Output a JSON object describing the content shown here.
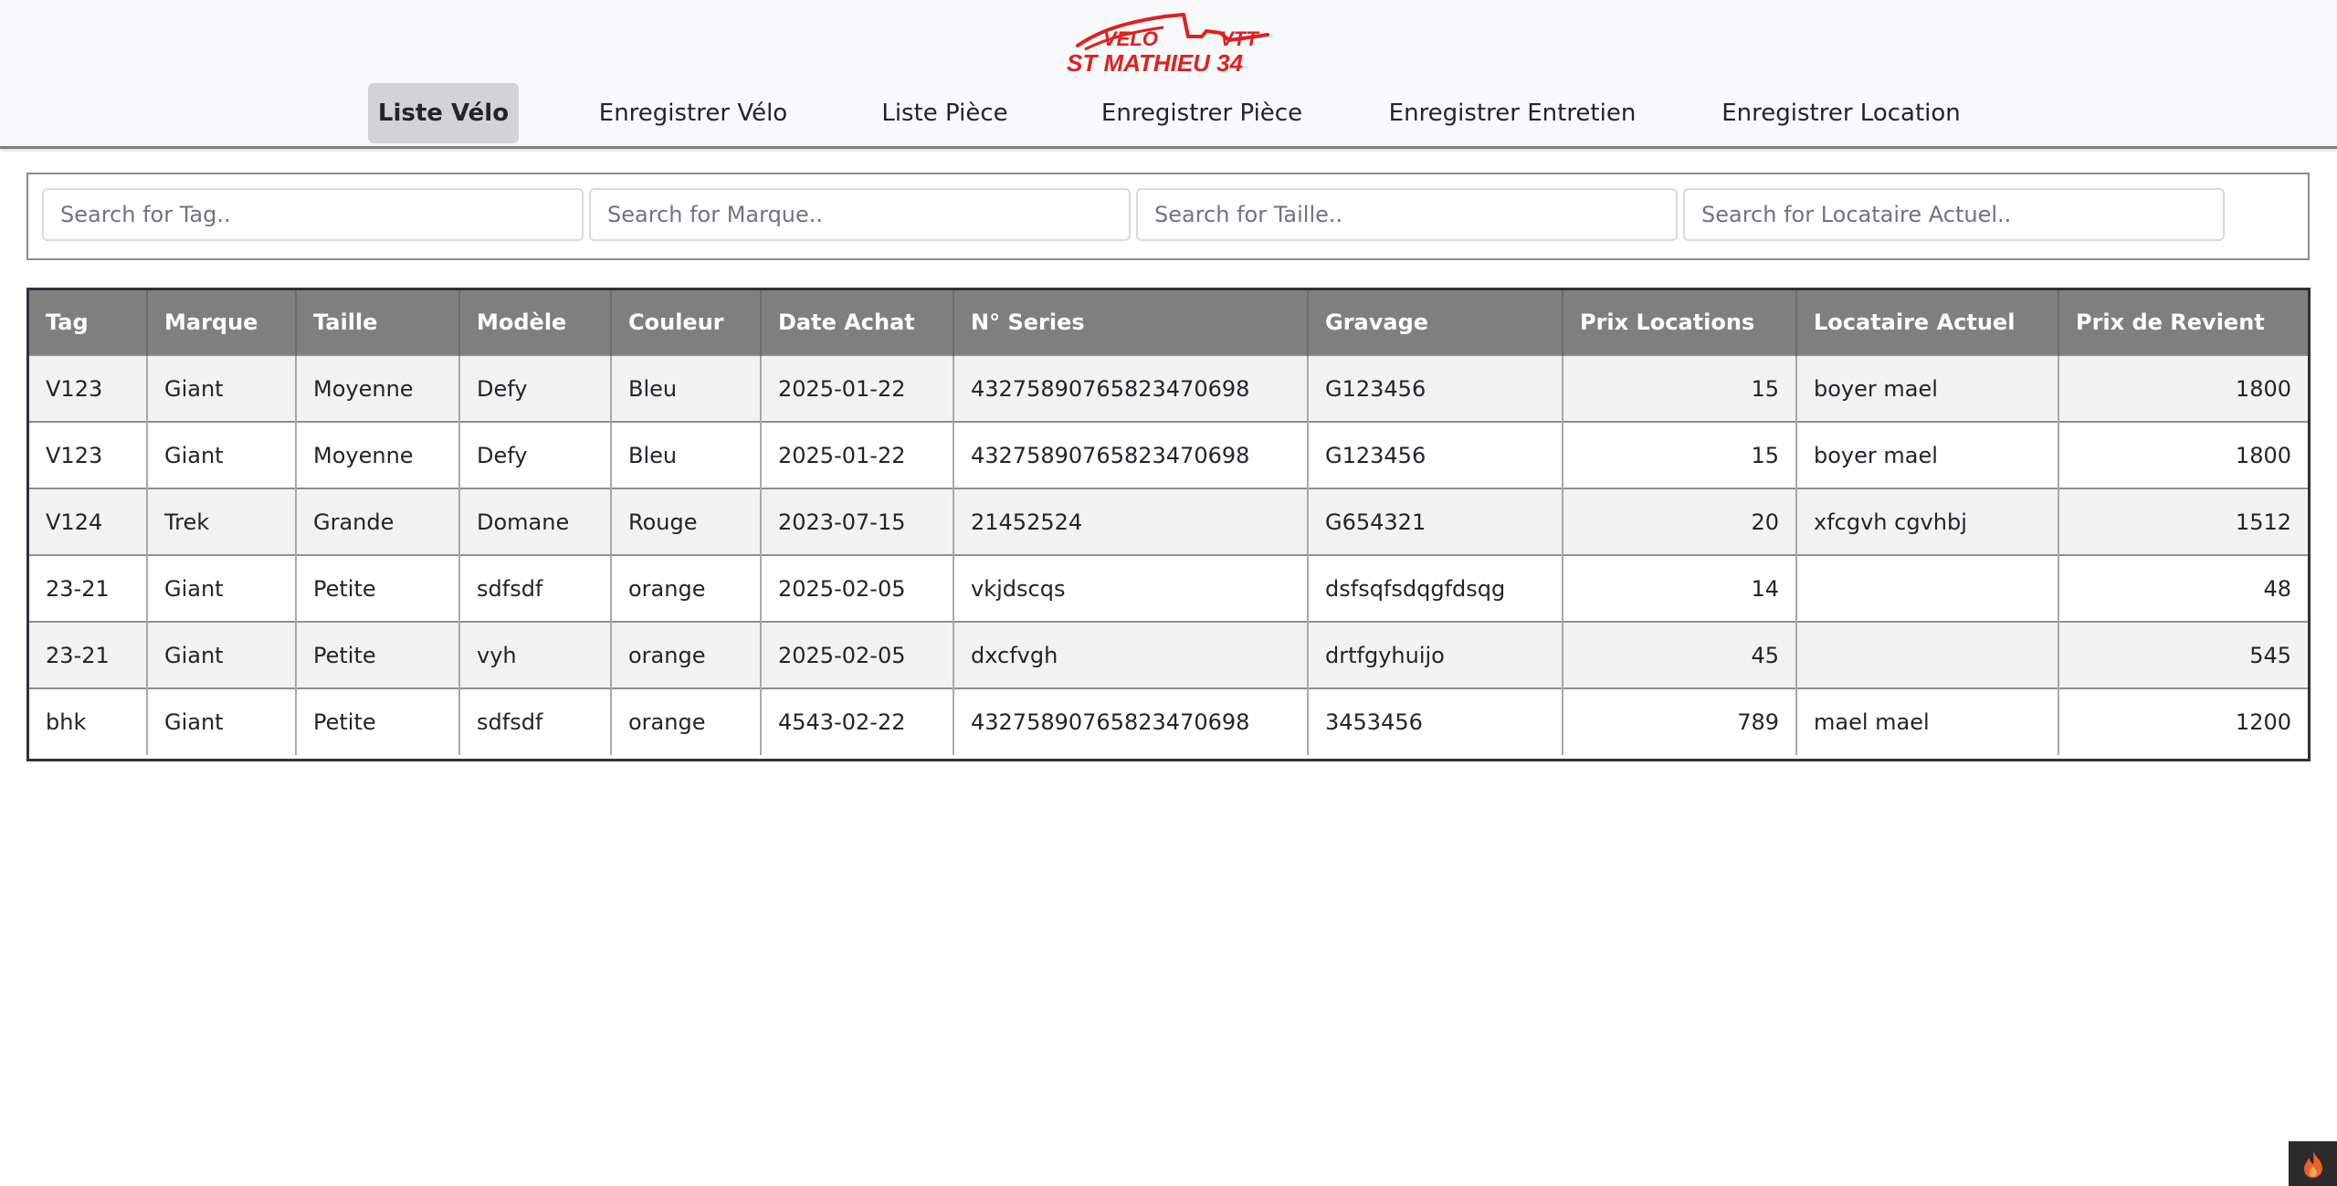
{
  "logo": {
    "line1_left": "VELO",
    "line1_right": "VTT",
    "line2": "ST MATHIEU 34",
    "color": "#e02020"
  },
  "nav": {
    "items": [
      {
        "label": "Liste Vélo",
        "active": true
      },
      {
        "label": "Enregistrer Vélo",
        "active": false
      },
      {
        "label": "Liste Pièce",
        "active": false
      },
      {
        "label": "Enregistrer Pièce",
        "active": false
      },
      {
        "label": "Enregistrer Entretien",
        "active": false
      },
      {
        "label": "Enregistrer Location",
        "active": false
      }
    ]
  },
  "filters": {
    "tag_placeholder": "Search for Tag..",
    "marque_placeholder": "Search for Marque..",
    "taille_placeholder": "Search for Taille..",
    "locataire_placeholder": "Search for Locataire Actuel.."
  },
  "table": {
    "headers": [
      "Tag",
      "Marque",
      "Taille",
      "Modèle",
      "Couleur",
      "Date Achat",
      "N° Series",
      "Gravage",
      "Prix Locations",
      "Locataire Actuel",
      "Prix de Revient"
    ],
    "rows": [
      [
        "V123",
        "Giant",
        "Moyenne",
        "Defy",
        "Bleu",
        "2025-01-22",
        "43275890765823470698",
        "G123456",
        "15",
        "boyer mael",
        "1800"
      ],
      [
        "V123",
        "Giant",
        "Moyenne",
        "Defy",
        "Bleu",
        "2025-01-22",
        "43275890765823470698",
        "G123456",
        "15",
        "boyer mael",
        "1800"
      ],
      [
        "V124",
        "Trek",
        "Grande",
        "Domane",
        "Rouge",
        "2023-07-15",
        "21452524",
        "G654321",
        "20",
        "xfcgvh cgvhbj",
        "1512"
      ],
      [
        "23-21",
        "Giant",
        "Petite",
        "sdfsdf",
        "orange",
        "2025-02-05",
        "vkjdscqs",
        "dsfsqfsdqgfdsqg",
        "14",
        "",
        "48"
      ],
      [
        "23-21",
        "Giant",
        "Petite",
        "vyh",
        "orange",
        "2025-02-05",
        "dxcfvgh",
        "drtfgyhuijo",
        "45",
        "",
        "545"
      ],
      [
        "bhk",
        "Giant",
        "Petite",
        "sdfsdf",
        "orange",
        "4543-02-22",
        "43275890765823470698",
        "3453456",
        "789",
        "mael mael",
        "1200"
      ]
    ]
  },
  "corner_icon": "flame-icon"
}
